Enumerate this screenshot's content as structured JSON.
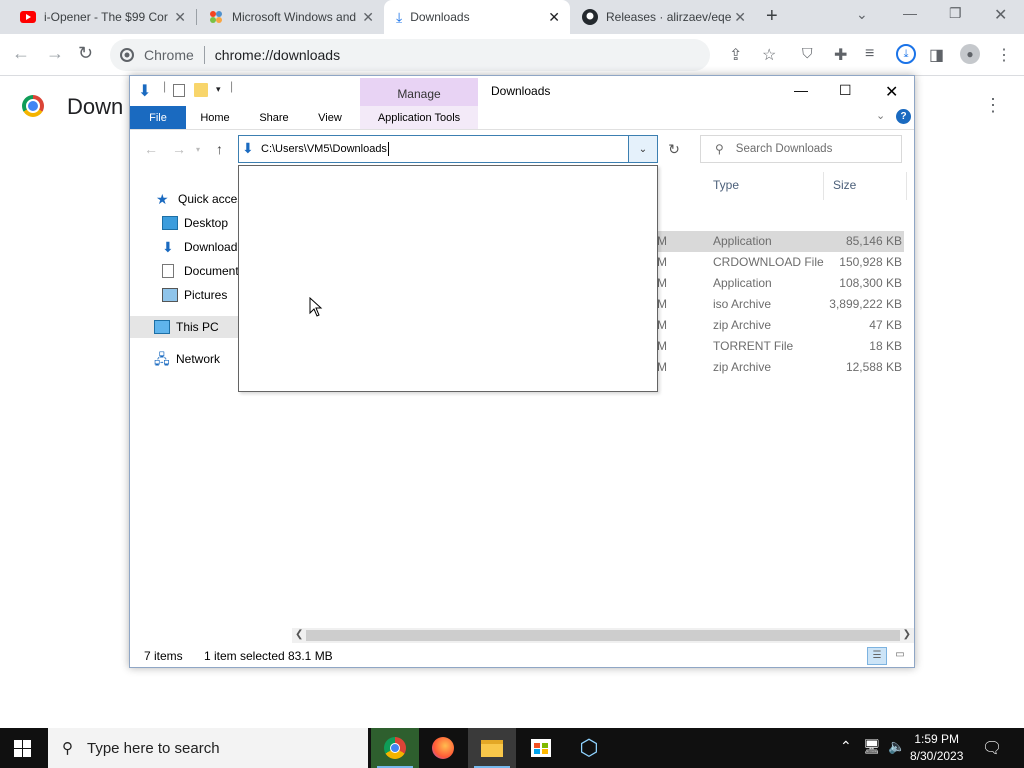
{
  "chrome": {
    "tabs": [
      {
        "title": "i-Opener - The $99 Cor",
        "icon": "youtube-icon"
      },
      {
        "title": "Microsoft Windows and",
        "icon": "joomla-icon"
      },
      {
        "title": "Downloads",
        "icon": "download-icon"
      },
      {
        "title": "Releases · alirzaev/eqe",
        "icon": "github-icon"
      }
    ],
    "omnibox_site": "Chrome",
    "omnibox_url": "chrome://downloads",
    "page_title": "Down"
  },
  "explorer": {
    "title": "Downloads",
    "manage_label": "Manage",
    "ribbon_tabs": {
      "file": "File",
      "home": "Home",
      "share": "Share",
      "view": "View",
      "app_tools": "Application Tools"
    },
    "address": "C:\\Users\\VM5\\Downloads",
    "search_placeholder": "Search Downloads",
    "nav": {
      "quick_access": "Quick acces",
      "desktop": "Desktop",
      "downloads": "Download",
      "documents": "Document",
      "pictures": "Pictures",
      "this_pc": "This PC",
      "network": "Network"
    },
    "columns": {
      "type": "Type",
      "size": "Size"
    },
    "files": [
      {
        "m": "M",
        "type": "Application",
        "size": "85,146 KB",
        "selected": true
      },
      {
        "m": "M",
        "type": "CRDOWNLOAD File",
        "size": "150,928 KB",
        "selected": false
      },
      {
        "m": "M",
        "type": "Application",
        "size": "108,300 KB",
        "selected": false
      },
      {
        "m": "M",
        "type": "iso Archive",
        "size": "3,899,222 KB",
        "selected": false
      },
      {
        "m": "M",
        "type": "zip Archive",
        "size": "47 KB",
        "selected": false
      },
      {
        "m": "M",
        "type": "TORRENT File",
        "size": "18 KB",
        "selected": false
      },
      {
        "m": "M",
        "type": "zip Archive",
        "size": "12,588 KB",
        "selected": false
      }
    ],
    "status": {
      "items": "7 items",
      "selected": "1 item selected",
      "size": "83.1 MB"
    }
  },
  "taskbar": {
    "search_placeholder": "Type here to search",
    "time": "1:59 PM",
    "date": "8/30/2023"
  }
}
